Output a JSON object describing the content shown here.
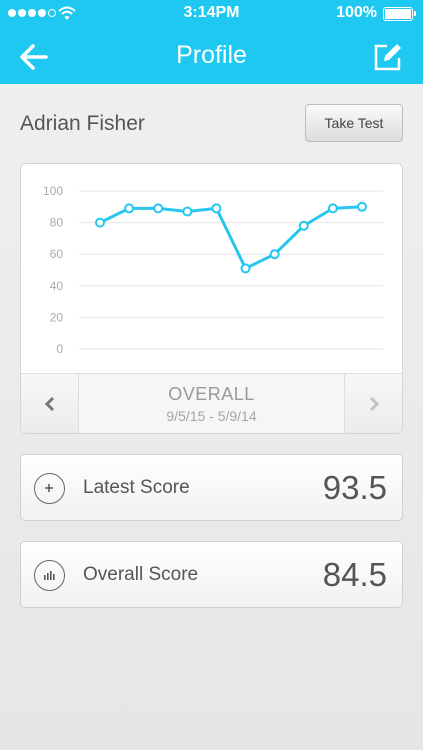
{
  "status_bar": {
    "time": "3:14PM",
    "battery": "100%"
  },
  "nav": {
    "title": "Profile",
    "back_icon": "arrow-left-icon",
    "edit_icon": "edit-icon"
  },
  "profile": {
    "name": "Adrian Fisher",
    "take_test_label": "Take Test"
  },
  "chart": {
    "label": "OVERALL",
    "date_range": "9/5/15 - 5/9/14",
    "line_color": "#27c6ef"
  },
  "chart_data": {
    "type": "line",
    "title": "OVERALL",
    "xlabel": "",
    "ylabel": "",
    "yticks": [
      "100",
      "80",
      "60",
      "40",
      "20",
      "0"
    ],
    "ylim": [
      0,
      100
    ],
    "grid": true,
    "series": [
      {
        "values": [
          80,
          89,
          89,
          87,
          89,
          51,
          60,
          78,
          89,
          90
        ]
      }
    ]
  },
  "scores": [
    {
      "label": "Latest Score",
      "value": "93.5",
      "icon": "plus-icon"
    },
    {
      "label": "Overall Score",
      "value": "84.5",
      "icon": "bar-chart-icon"
    }
  ],
  "colors": {
    "accent": "#1fc8f0",
    "background": "#ececec"
  }
}
